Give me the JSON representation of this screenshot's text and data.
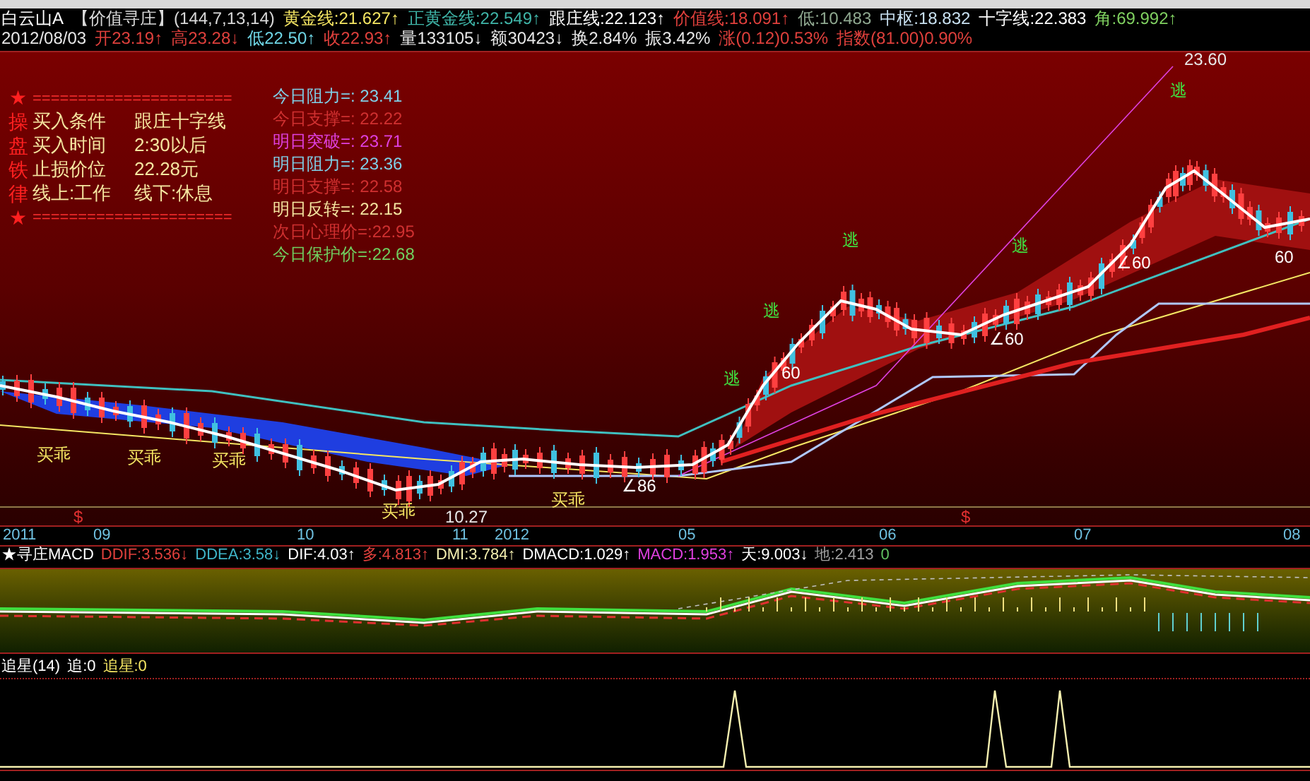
{
  "header": {
    "stock": "白云山A",
    "indicator": "【价值寻庄】",
    "params": "(144,7,13,14)",
    "readings": [
      {
        "text": "黄金线:21.627↑",
        "color": "#f5e663"
      },
      {
        "text": "正黄金线:22.549↑",
        "color": "#3fb5a8"
      },
      {
        "text": "跟庄线:22.123↑",
        "color": "#ffffff"
      },
      {
        "text": "价值线:18.091↑",
        "color": "#e0403c"
      },
      {
        "text": "低:10.483",
        "color": "#8fa890"
      },
      {
        "text": "中枢:18.832",
        "color": "#c8e0f0"
      },
      {
        "text": "十字线:22.383",
        "color": "#ffffff"
      },
      {
        "text": "角:69.992↑",
        "color": "#7fd060"
      }
    ],
    "date": "2012/08/03",
    "quotes": [
      {
        "text": "开23.19↑",
        "color": "#e0403c"
      },
      {
        "text": "高23.28↓",
        "color": "#e0403c"
      },
      {
        "text": "低22.50↑",
        "color": "#6fd6e6"
      },
      {
        "text": "收22.93↑",
        "color": "#e0403c"
      },
      {
        "text": "量133105↓",
        "color": "#e8e8e8"
      },
      {
        "text": "额30423↓",
        "color": "#e8e8e8"
      },
      {
        "text": "换2.84%",
        "color": "#e8e8e8"
      },
      {
        "text": "振3.42%",
        "color": "#e8e8e8"
      },
      {
        "text": "涨(0.12)0.53%",
        "color": "#e0403c"
      },
      {
        "text": "指数(81.00)0.90%",
        "color": "#e0403c"
      }
    ]
  },
  "rules_panel": {
    "side": [
      "★",
      "操",
      "盘",
      "铁",
      "律",
      "★"
    ],
    "rule": "======================",
    "rows": [
      [
        "买入条件",
        "跟庄十字线"
      ],
      [
        "买入时间",
        "2:30以后"
      ],
      [
        "止损价位",
        "22.28元"
      ],
      [
        "线上:工作",
        "线下:休息"
      ]
    ]
  },
  "levels": [
    {
      "text": "今日阻力=: 23.41",
      "color": "#7fd0e8"
    },
    {
      "text": "今日支撑=: 22.22",
      "color": "#d03030"
    },
    {
      "text": "明日突破=: 23.71",
      "color": "#e040e0"
    },
    {
      "text": "明日阻力=: 23.36",
      "color": "#7fd0e8"
    },
    {
      "text": "明日支撑=: 22.58",
      "color": "#d03030"
    },
    {
      "text": "明日反转=: 22.15",
      "color": "#f5e6a0"
    },
    {
      "text": "次日心理价=:22.95",
      "color": "#d03030"
    },
    {
      "text": "今日保护价=:22.68",
      "color": "#70d060"
    }
  ],
  "chart": {
    "labels": [
      {
        "text": "23.60",
        "kind": "price"
      },
      {
        "text": "逃",
        "kind": "escape"
      },
      {
        "text": "逃",
        "kind": "escape"
      },
      {
        "text": "逃",
        "kind": "escape"
      },
      {
        "text": "逃",
        "kind": "escape"
      },
      {
        "text": "逃",
        "kind": "escape"
      },
      {
        "text": "买乖",
        "kind": "buy"
      },
      {
        "text": "买乖",
        "kind": "buy"
      },
      {
        "text": "买乖",
        "kind": "buy"
      },
      {
        "text": "买乖",
        "kind": "buy"
      },
      {
        "text": "买乖",
        "kind": "buy"
      },
      {
        "text": "10.27",
        "kind": "price"
      },
      {
        "text": "60",
        "kind": "angle"
      },
      {
        "text": "∠86",
        "kind": "angle"
      },
      {
        "text": "∠60",
        "kind": "angle"
      },
      {
        "text": "∠60",
        "kind": "angle"
      },
      {
        "text": "60",
        "kind": "angle"
      },
      {
        "text": "$",
        "kind": "signal"
      },
      {
        "text": "$",
        "kind": "signal"
      }
    ],
    "axis": [
      "2011",
      "09",
      "10",
      "11",
      "2012",
      "05",
      "06",
      "07",
      "08"
    ]
  },
  "lower_panel": {
    "legend": [
      "★寻庄MACD",
      "DDIF:3.536↓",
      "DDEA:3.58↓",
      "DIF:4.03↑",
      "多:4.813↑",
      "DMI:3.784↑",
      "DMACD:1.029↑",
      "MACD:1.953↑",
      "天:9.003↓",
      "地:2.413",
      "0"
    ]
  },
  "star": {
    "readings": [
      {
        "text": "追星(14)",
        "color": "#ffffff"
      },
      {
        "text": "追:0",
        "color": "#ffffff"
      },
      {
        "text": "追星:0",
        "color": "#f5e663"
      }
    ]
  }
}
